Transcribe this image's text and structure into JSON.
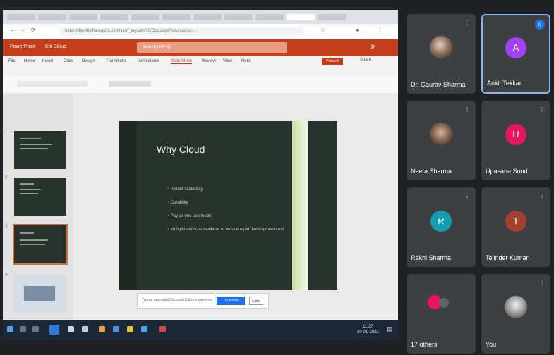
{
  "shared_screen": {
    "browser": {
      "tab_count": 13,
      "url": "https://dkpptl.sharepoint.com/:p:/r/_layouts/15/Doc.aspx?sourcedoc=..."
    },
    "ppt": {
      "app_name": "PowerPoint",
      "file_title": "Kiti Cloud",
      "search_placeholder": "Search (Alt+Q)",
      "menu_items": [
        "File",
        "Home",
        "Insert",
        "Draw",
        "Design",
        "Transitions",
        "Animations",
        "Slide Show",
        "Review",
        "View",
        "Help"
      ],
      "active_menu": "Slide Show",
      "slide_show_button": "Present",
      "share_button": "Share",
      "slide_numbers": [
        "1",
        "2",
        "3",
        "4"
      ],
      "selected_slide": 3,
      "slide": {
        "title": "Why Cloud",
        "bullets": [
          "Instant scalability",
          "Durability",
          "Pay as you use model",
          "Multiple services available to reduce rapid development cost"
        ]
      },
      "notification": {
        "text": "Try our upgraded Microsoft Editor experience",
        "primary": "Try it now",
        "secondary": "Later"
      }
    },
    "taskbar": {
      "time": "11:27",
      "date": "10-01-2022"
    }
  },
  "participants": [
    {
      "name": "Dr. Gaurav Sharma",
      "type": "photo",
      "muted": true
    },
    {
      "name": "Ankit Tekkar",
      "type": "initial",
      "initial": "A",
      "color": "#a142f4",
      "active": true
    },
    {
      "name": "Neeta Sharma",
      "type": "photo",
      "muted": true
    },
    {
      "name": "Upasana Sood",
      "type": "initial",
      "initial": "U",
      "color": "#e8175d",
      "muted": true
    },
    {
      "name": "Rakhi Sharma",
      "type": "initial",
      "initial": "R",
      "color": "#129eaf",
      "muted": true
    },
    {
      "name": "Tejinder Kumar",
      "type": "initial",
      "initial": "T",
      "color": "#a2402e",
      "muted": true
    },
    {
      "name": "17 others",
      "type": "group"
    },
    {
      "name": "You",
      "type": "photo",
      "muted": true
    }
  ]
}
